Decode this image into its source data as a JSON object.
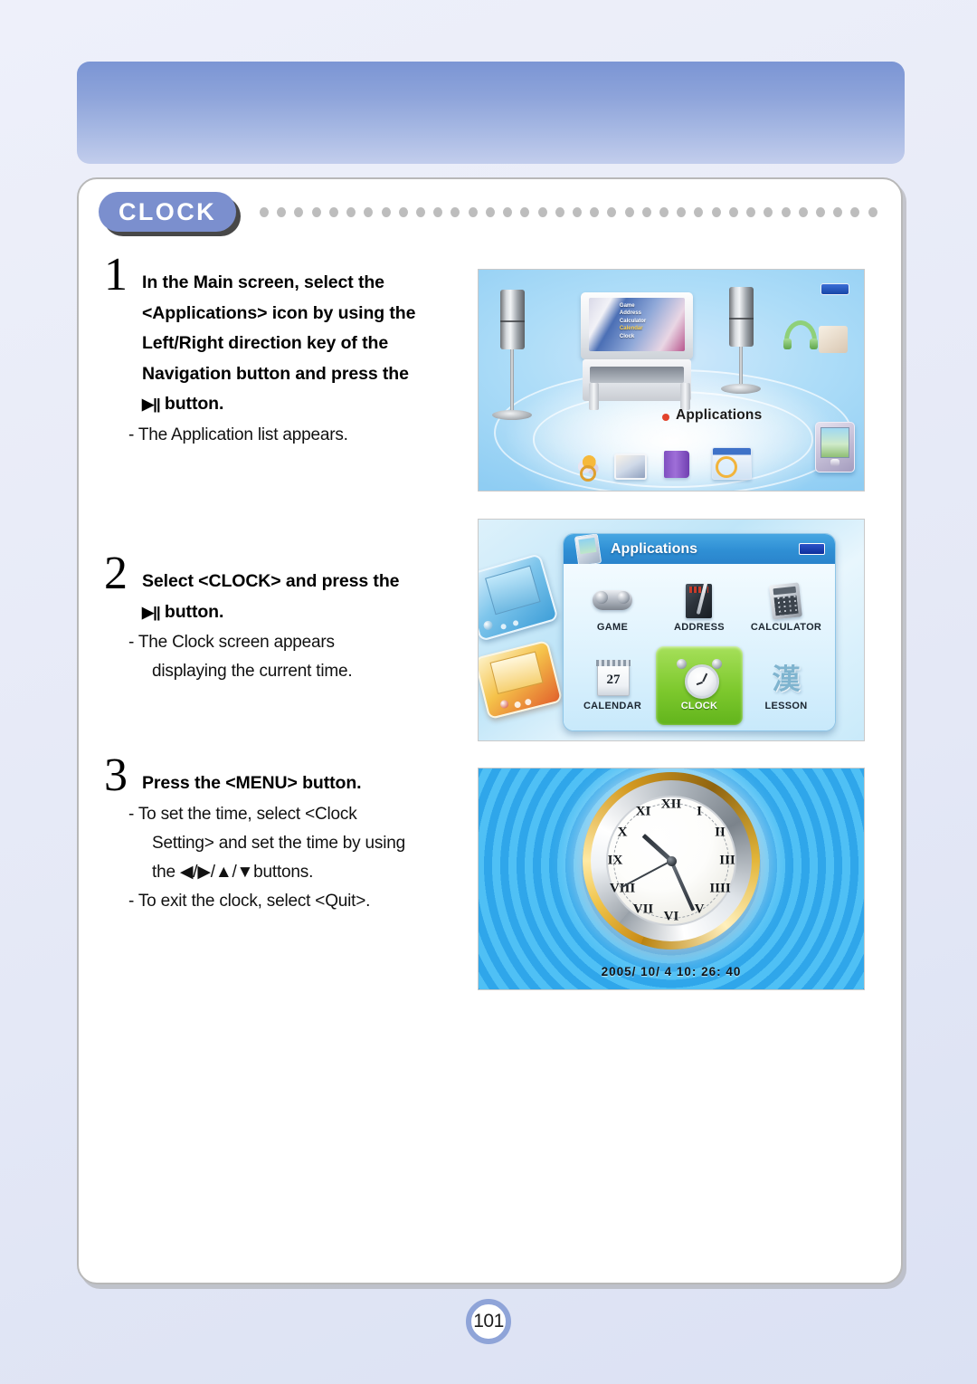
{
  "page": {
    "number": "101",
    "section_title": "CLOCK"
  },
  "steps": [
    {
      "number": "1",
      "title_lines": [
        "In the Main screen, select the",
        "<Applications> icon by using the",
        "Left/Right direction key of the",
        "Navigation button and press the"
      ],
      "title_last": "button.",
      "button_symbol": "▶||",
      "notes": [
        "- The Application list appears."
      ]
    },
    {
      "number": "2",
      "title_lines": [
        "Select <CLOCK> and press the"
      ],
      "title_last": "button.",
      "button_symbol": "▶||",
      "notes": [
        "- The Clock screen appears",
        "displaying the current time."
      ]
    },
    {
      "number": "3",
      "title_lines": [
        "Press the <MENU> button."
      ],
      "title_last": "",
      "button_symbol": "",
      "notes": [
        "- To set the time, select <Clock",
        "Setting> and set the time by using",
        "the ◀/▶/▲/▼buttons.",
        "- To exit the clock, select <Quit>."
      ]
    }
  ],
  "figures": {
    "main_screen": {
      "caption_label": "Applications",
      "tv_menu": [
        "Game",
        "Address",
        "Calculator",
        "Calendar",
        "Clock"
      ],
      "tv_menu_highlighted": "Calendar"
    },
    "applications_menu": {
      "window_title": "Applications",
      "items": [
        {
          "label": "GAME",
          "icon": "gamepad-icon",
          "selected": false
        },
        {
          "label": "ADDRESS",
          "icon": "notebook-icon",
          "selected": false
        },
        {
          "label": "CALCULATOR",
          "icon": "calculator-icon",
          "selected": false
        },
        {
          "label": "CALENDAR",
          "icon": "calendar-icon",
          "selected": false,
          "day": "27"
        },
        {
          "label": "CLOCK",
          "icon": "alarm-clock-icon",
          "selected": true
        },
        {
          "label": "LESSON",
          "icon": "lesson-kanji-icon",
          "selected": false,
          "glyph": "漢"
        }
      ]
    },
    "clock_screen": {
      "datetime": "2005/ 10/  4   10: 26: 40",
      "numerals": [
        "XII",
        "I",
        "II",
        "III",
        "IIII",
        "V",
        "VI",
        "VII",
        "VIII",
        "IX",
        "X",
        "XI"
      ]
    }
  },
  "colors": {
    "badge_blue": "#7b8fce",
    "banner_top": "#7b95d4",
    "banner_bottom": "#c2cdec",
    "page_bg": "#e6eaf7",
    "selected_green": "#7ec92e",
    "accent_red": "#e2432c"
  }
}
